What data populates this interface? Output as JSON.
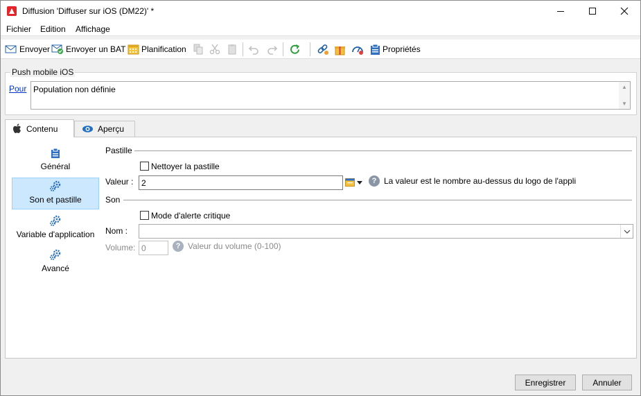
{
  "window": {
    "title": "Diffusion 'Diffuser sur iOS (DM22)' *"
  },
  "menu": [
    "Fichier",
    "Edition",
    "Affichage"
  ],
  "toolbar": {
    "send": "Envoyer",
    "send_bat": "Envoyer un BAT",
    "planning": "Planification",
    "properties": "Propriétés"
  },
  "group": {
    "title": "Push mobile iOS",
    "pour_label": "Pour",
    "population": "Population non définie"
  },
  "tabs": {
    "content": "Contenu",
    "preview": "Aperçu"
  },
  "nav": {
    "general": "Général",
    "sound_badge": "Son et pastille",
    "app_variable": "Variable d'application",
    "advanced": "Avancé"
  },
  "form": {
    "badge_section": "Pastille",
    "clear_badge": "Nettoyer la pastille",
    "value_label": "Valeur :",
    "value": "2",
    "value_help": "La valeur est le nombre au-dessus du logo de l'appli",
    "sound_section": "Son",
    "critical_alert": "Mode d'alerte critique",
    "name_label": "Nom :",
    "name_value": "",
    "volume_label": "Volume:",
    "volume_value": "0",
    "volume_help": "Valeur du volume (0-100)"
  },
  "buttons": {
    "save": "Enregistrer",
    "cancel": "Annuler"
  },
  "colors": {
    "accent": "#0078d7",
    "selection": "#cce8ff",
    "brand": "#e4262b"
  }
}
